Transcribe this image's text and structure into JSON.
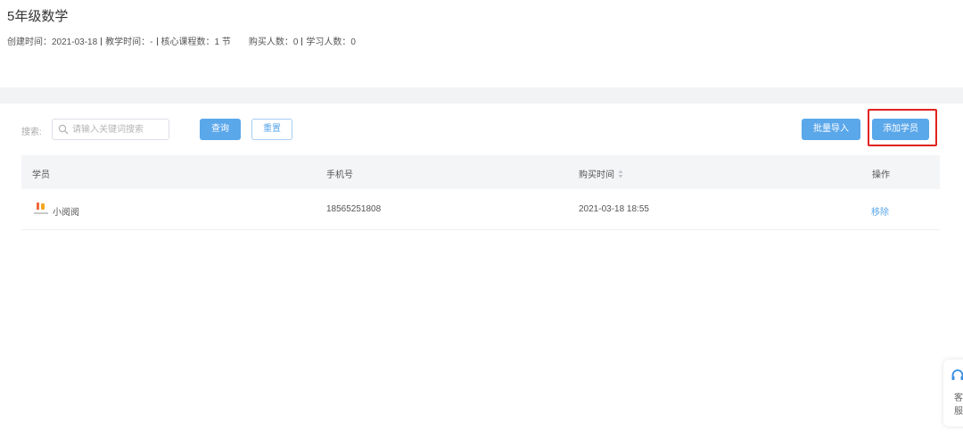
{
  "header": {
    "title": "5年级数学",
    "meta": {
      "created": "创建时间：2021-03-18",
      "teaching_time": "教学时间：-",
      "core_courses": "核心课程数：1 节",
      "buyers": "购买人数：0",
      "learners": "学习人数：0"
    }
  },
  "toolbar": {
    "search_label": "搜索:",
    "search_placeholder": "请输入关键词搜索",
    "search_value": "",
    "query_label": "查询",
    "reset_label": "重置",
    "batch_import_label": "批量导入",
    "add_student_label": "添加学员"
  },
  "table": {
    "columns": [
      "学员",
      "手机号",
      "购买时间",
      "操作"
    ],
    "rows": [
      {
        "student": "小阅阅",
        "phone": "18565251808",
        "purchase_time": "2021-03-18 18:55",
        "action": "移除"
      }
    ]
  },
  "service": {
    "label": "客服"
  },
  "colors": {
    "accent": "#5aa7ea",
    "highlight": "#e0231f",
    "header_bg": "#f4f5f7",
    "band_bg": "#f2f3f5"
  },
  "icons": {
    "search": "search-icon",
    "sort": "sort-icon",
    "avatar": "avatar-logo",
    "service": "headset-icon"
  }
}
